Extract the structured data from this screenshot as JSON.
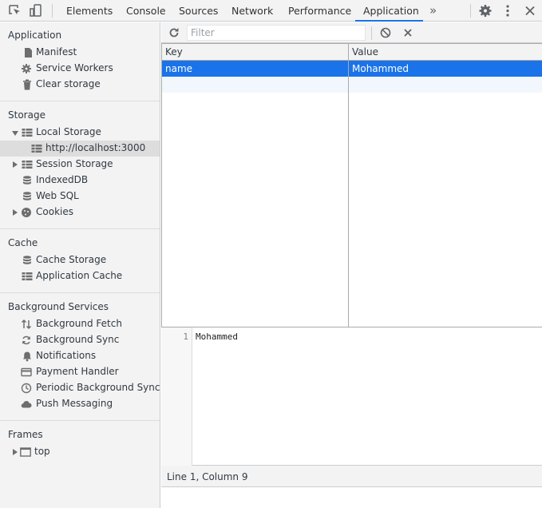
{
  "devtools": {
    "tabs": [
      "Elements",
      "Console",
      "Sources",
      "Network",
      "Performance",
      "Application"
    ],
    "active_tab": "Application",
    "overflow_icon": "chevron-double-right-icon",
    "accent_color": "#1a73e8"
  },
  "sidebar": {
    "application": {
      "title": "Application",
      "items": [
        {
          "label": "Manifest",
          "icon": "file-icon"
        },
        {
          "label": "Service Workers",
          "icon": "gear-icon"
        },
        {
          "label": "Clear storage",
          "icon": "trash-icon"
        }
      ]
    },
    "storage": {
      "title": "Storage",
      "local_storage": {
        "label": "Local Storage",
        "expanded": true
      },
      "origin": "http://localhost:3000",
      "session_storage": "Session Storage",
      "indexeddb": "IndexedDB",
      "websql": "Web SQL",
      "cookies": "Cookies"
    },
    "cache": {
      "title": "Cache",
      "items": [
        {
          "label": "Cache Storage",
          "icon": "database-icon"
        },
        {
          "label": "Application Cache",
          "icon": "table-icon"
        }
      ]
    },
    "background": {
      "title": "Background Services",
      "items": [
        {
          "label": "Background Fetch",
          "icon": "up-down-arrows-icon"
        },
        {
          "label": "Background Sync",
          "icon": "sync-icon"
        },
        {
          "label": "Notifications",
          "icon": "bell-icon"
        },
        {
          "label": "Payment Handler",
          "icon": "card-icon"
        },
        {
          "label": "Periodic Background Sync",
          "icon": "clock-icon"
        },
        {
          "label": "Push Messaging",
          "icon": "cloud-icon"
        }
      ]
    },
    "frames": {
      "title": "Frames",
      "top": "top"
    }
  },
  "toolbar": {
    "filter_placeholder": "Filter"
  },
  "table": {
    "headers": [
      "Key",
      "Value"
    ],
    "rows": [
      {
        "key": "name",
        "value": "Mohammed",
        "selected": true
      }
    ]
  },
  "preview": {
    "line_number": "1",
    "content": "Mohammed"
  },
  "status": "Line 1, Column 9"
}
